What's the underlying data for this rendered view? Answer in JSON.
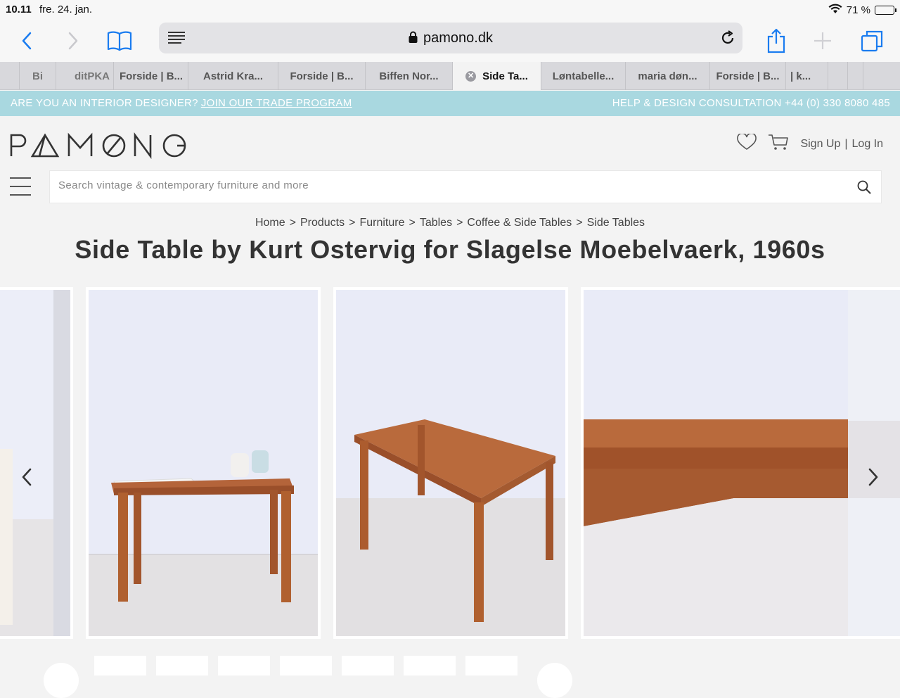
{
  "status_bar": {
    "time": "10.11",
    "date": "fre. 24. jan.",
    "battery": "71 %",
    "battery_level": 0.71
  },
  "browser": {
    "url": "pamono.dk",
    "tabs": [
      {
        "label": "Bi"
      },
      {
        "label": "ditPKA"
      },
      {
        "label": "Forside | B..."
      },
      {
        "label": "Astrid Kra..."
      },
      {
        "label": "Forside | B..."
      },
      {
        "label": "Biffen Nor..."
      },
      {
        "label": "Side Ta...",
        "active": true
      },
      {
        "label": "Løntabelle..."
      },
      {
        "label": "maria døn..."
      },
      {
        "label": "Forside | B..."
      },
      {
        "label": "| k..."
      }
    ]
  },
  "banner": {
    "question": "ARE YOU AN INTERIOR DESIGNER?",
    "link": "JOIN OUR TRADE PROGRAM",
    "help": "HELP & DESIGN CONSULTATION +44 (0) 330 8080 485"
  },
  "header": {
    "logo": "PAMONO",
    "signup": "Sign Up",
    "divider": "|",
    "login": "Log In"
  },
  "search": {
    "placeholder": "Search vintage & contemporary furniture and more"
  },
  "breadcrumb": [
    "Home",
    "Products",
    "Furniture",
    "Tables",
    "Coffee & Side Tables",
    "Side Tables"
  ],
  "breadcrumb_sep": ">",
  "product": {
    "title": "Side Table by Kurt Ostervig for Slagelse Moebelvaerk, 1960s"
  },
  "colors": {
    "banner": "#a9d8e0",
    "teak": "#b4643a",
    "wall": "#e9ebf7"
  }
}
